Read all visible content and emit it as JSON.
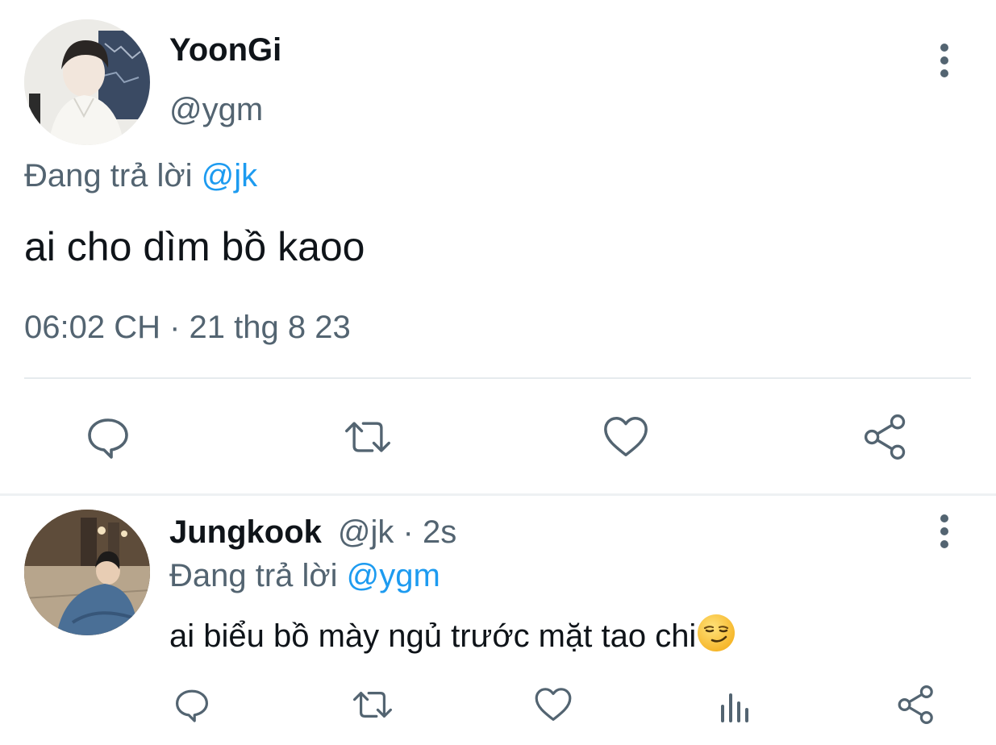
{
  "main_tweet": {
    "display_name": "YoonGi",
    "handle": "@ygm",
    "replying_prefix": "Đang trả lời ",
    "replying_to": "@jk",
    "text": "ai cho dìm bồ kaoo",
    "timestamp": "06:02 CH · 21 thg 8 23",
    "actions": {
      "reply_icon": "reply-icon",
      "retweet_icon": "retweet-icon",
      "like_icon": "heart-icon",
      "share_icon": "share-icon"
    }
  },
  "reply_tweet": {
    "display_name": "Jungkook",
    "handle_time": "@jk · 2s",
    "replying_prefix": "Đang trả lời ",
    "replying_to": "@ygm",
    "text": "ai biểu bồ mày ngủ trước mặt tao chi",
    "emoji": "smirking-face-emoji",
    "actions": {
      "reply_icon": "reply-icon",
      "retweet_icon": "retweet-icon",
      "like_icon": "heart-icon",
      "analytics_icon": "analytics-icon",
      "share_icon": "share-icon"
    }
  },
  "colors": {
    "text_primary": "#0f1419",
    "text_secondary": "#536471",
    "link_blue": "#1d9bf0",
    "divider": "#e6ebee"
  }
}
